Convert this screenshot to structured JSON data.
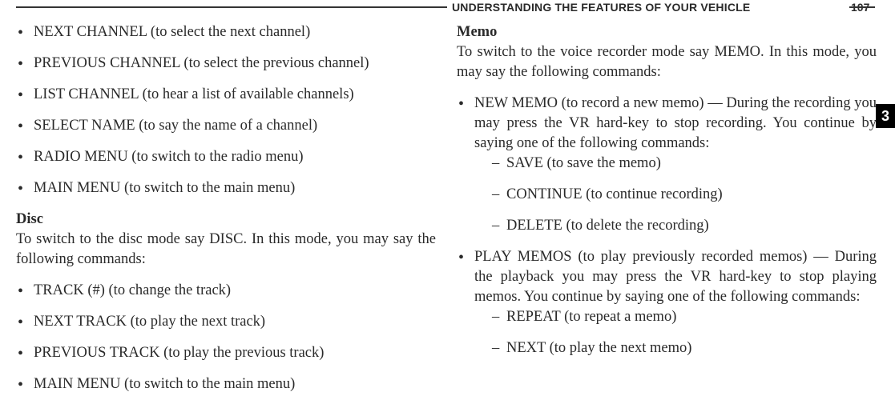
{
  "header": {
    "title": "UNDERSTANDING THE FEATURES OF YOUR VEHICLE",
    "page": "107",
    "chapter": "3"
  },
  "left": {
    "bullets_top": [
      "NEXT CHANNEL (to select the next channel)",
      "PREVIOUS CHANNEL (to select the previous channel)",
      "LIST CHANNEL (to hear a list of available channels)",
      "SELECT NAME (to say the name of a channel)",
      "RADIO MENU (to switch to the radio menu)",
      "MAIN MENU (to switch to the main menu)"
    ],
    "disc": {
      "title": "Disc",
      "intro": "To switch to the disc mode say DISC. In this mode, you may say the following commands:",
      "bullets": [
        "TRACK (#) (to change the track)",
        "NEXT TRACK (to play the next track)",
        "PREVIOUS TRACK (to play the previous track)",
        "MAIN MENU (to switch to the main menu)"
      ]
    }
  },
  "right": {
    "memo": {
      "title": "Memo",
      "intro": "To switch to the voice recorder mode say MEMO. In this mode, you may say the following commands:",
      "item1": "NEW MEMO (to record a new memo) — During the recording you may press the VR hard-key to stop recording. You continue by saying one of the following commands:",
      "item1_sub": [
        "SAVE (to save the memo)",
        "CONTINUE (to continue recording)",
        "DELETE (to delete the recording)"
      ],
      "item2": "PLAY MEMOS (to play previously recorded memos) — During the playback you may press the VR hard-key to stop playing memos. You continue by saying one of the following commands:",
      "item2_sub": [
        "REPEAT (to repeat a memo)",
        "NEXT (to play the next memo)"
      ]
    }
  }
}
